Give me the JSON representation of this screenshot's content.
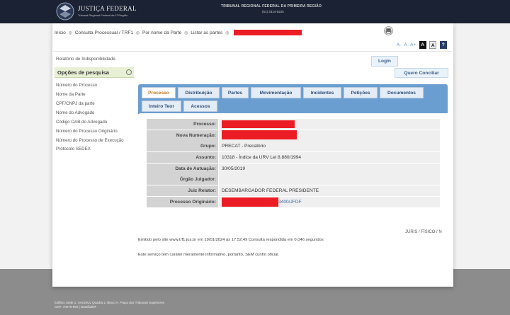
{
  "header": {
    "logo_title": "JUSTIÇA FEDERAL",
    "logo_subtitle": "Tribunal Regional Federal da 1ª Região",
    "court_name": "TRIBUNAL REGIONAL FEDERAL DA PRIMEIRA REGIÃO",
    "phone": "(61) 3314-5225"
  },
  "breadcrumb": {
    "items": [
      "Início",
      "Consulta Processual / TRF1",
      "Por nome da Parte",
      "Listar as partes"
    ],
    "separator": "◎"
  },
  "font_controls": {
    "decrease": "A-",
    "normal": "A",
    "increase": "A+",
    "contrast_dark": "A",
    "contrast_light": "A",
    "help": "?"
  },
  "sidebar": {
    "report_link": "Relatório de Indisponibilidade",
    "search_title": "Opções de pesquisa",
    "items": [
      "Número do Processo",
      "Nome da Parte",
      "CPF/CNPJ da parte",
      "Nome do Advogado",
      "Código OAB do Advogado",
      "Número do Processo Originário",
      "Número do Processo de Execução",
      "Protocolo SEDEX"
    ]
  },
  "buttons": {
    "login": "Login",
    "concil": "Quero Conciliar"
  },
  "tabs": {
    "row1": [
      "Processo",
      "Distribuição",
      "Partes",
      "Movimentação",
      "Incidentes",
      "Petições",
      "Documentos"
    ],
    "row2": [
      "Inteiro Teor",
      "Acessos"
    ],
    "active": "Processo"
  },
  "details": {
    "rows": [
      {
        "label": "Processo:",
        "value": ""
      },
      {
        "label": "Nova Numeração:",
        "value": ""
      },
      {
        "label": "Grupo:",
        "value": "PRECAT - Precatório"
      },
      {
        "label": "Assunto:",
        "value": "10318 - Índice da URV Lei 8.880/1994"
      },
      {
        "label": "Data de Autuação:",
        "value": "30/05/2019"
      },
      {
        "label": "Órgão Julgador:",
        "value": ""
      },
      {
        "label": "Juiz Relator:",
        "value": "DESEMBARGADOR FEDERAL PRESIDENTE"
      },
      {
        "label": "Processo Originário:",
        "value": "3400/JFDF"
      }
    ]
  },
  "juris": "JURIS / FÍSICO / N",
  "emitido": "Emitido pelo site www.trf1.jus.br em 19/01/2024 às 17:52:49 Consulta respondida em 0,046 segundos",
  "servico": "Este serviço tem caráter meramente informativo, portanto, SEM cunho oficial.",
  "footer": {
    "line1": "Edifício Sede 1: SAU/SUL Quadra 2, Bloco A, Praça dos Tribunais Superiores",
    "line2": "CEP: 70070-900 | Brasília/DF"
  },
  "colors": {
    "header_bg": "#1b2233",
    "tab_bar": "#6b9ed0",
    "active_tab_text": "#c0701a",
    "redaction": "#ec1c24"
  }
}
